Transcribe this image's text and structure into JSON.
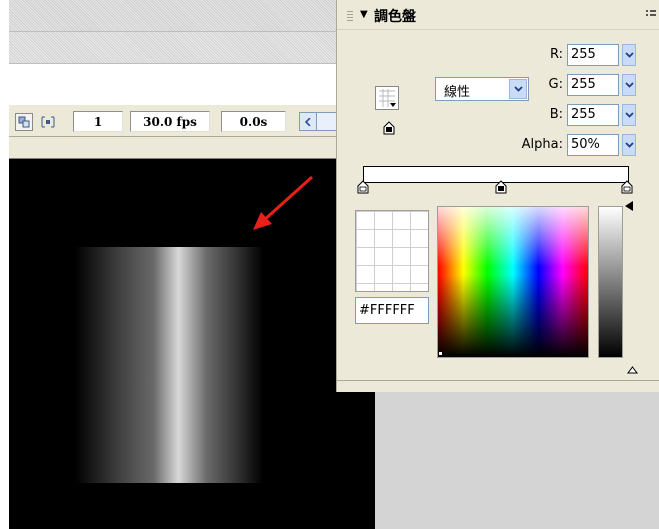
{
  "timeline": {
    "frame": "1",
    "fps": "30.0 fps",
    "time": "0.0s"
  },
  "color_mixer": {
    "title": "調色盤",
    "fill_type": "線性",
    "r_label": "R:",
    "r_value": "255",
    "g_label": "G:",
    "g_value": "255",
    "b_label": "B:",
    "b_value": "255",
    "alpha_label": "Alpha:",
    "alpha_value": "50%",
    "hex_value": "#FFFFFF"
  },
  "colors": {
    "accent_arrow": "#e8201a",
    "panel_bg": "#ece9d8",
    "stage_bg": "#000000"
  },
  "icons": [
    "onion-skin-icon",
    "edit-multiple-frames-icon",
    "scroll-left-icon",
    "fill-swatch-icon",
    "collapse-triangle-icon",
    "panel-options-icon",
    "gradient-stop-icon",
    "dropdown-arrow-icon"
  ]
}
